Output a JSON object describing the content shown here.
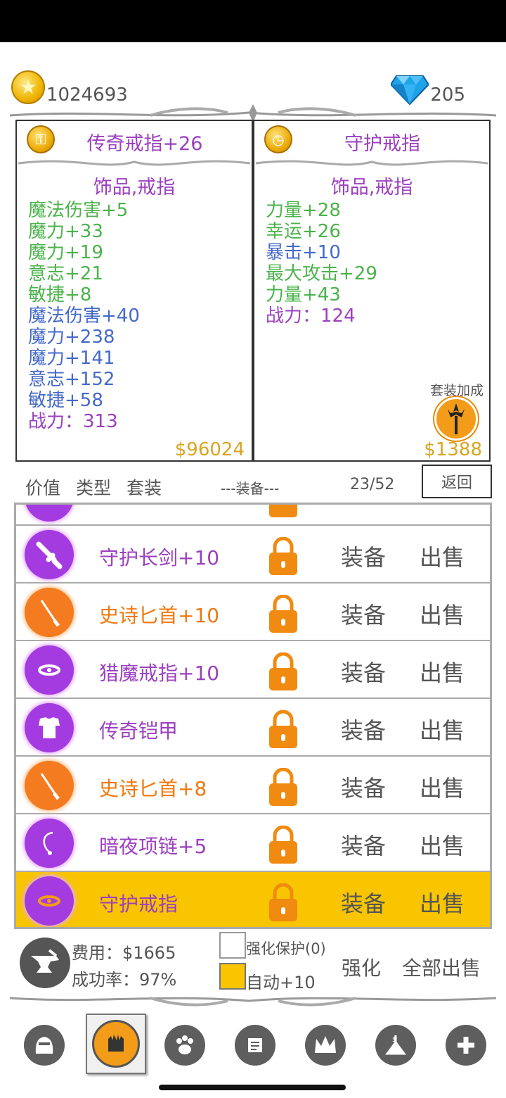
{
  "currency": {
    "gold": "1024693",
    "gems": "205"
  },
  "left_item": {
    "title": "传奇戒指+26",
    "type": "饰品,戒指",
    "stats": [
      {
        "text": "魔法伤害+5",
        "color": "green"
      },
      {
        "text": "魔力+33",
        "color": "green"
      },
      {
        "text": "魔力+19",
        "color": "green"
      },
      {
        "text": "意志+21",
        "color": "green"
      },
      {
        "text": "敏捷+8",
        "color": "green"
      },
      {
        "text": "魔法伤害+40",
        "color": "blue"
      },
      {
        "text": "魔力+238",
        "color": "blue"
      },
      {
        "text": "魔力+141",
        "color": "blue"
      },
      {
        "text": "意志+152",
        "color": "blue"
      },
      {
        "text": "敏捷+58",
        "color": "blue"
      },
      {
        "text": "战力：313",
        "color": "purple"
      }
    ],
    "price": "$96024"
  },
  "right_item": {
    "title": "守护戒指",
    "type": "饰品,戒指",
    "stats": [
      {
        "text": "力量+28",
        "color": "green"
      },
      {
        "text": "幸运+26",
        "color": "green"
      },
      {
        "text": "暴击+10",
        "color": "blue"
      },
      {
        "text": "最大攻击+29",
        "color": "green"
      },
      {
        "text": "力量+43",
        "color": "green"
      },
      {
        "text": "战力：124",
        "color": "purple"
      }
    ],
    "set_bonus_label": "套装加成",
    "price": "$1388"
  },
  "sortbar": {
    "value_label": "价值",
    "type_label": "类型",
    "set_label": "套装",
    "section_label": "---装备---",
    "count": "23/52",
    "back_label": "返回"
  },
  "inventory": [
    {
      "name": "守护长剑+10",
      "rarity": "purple",
      "icon": "sword-icon",
      "equip": "装备",
      "sell": "出售"
    },
    {
      "name": "史诗匕首+10",
      "rarity": "orange",
      "icon": "dagger-icon",
      "equip": "装备",
      "sell": "出售"
    },
    {
      "name": "猎魔戒指+10",
      "rarity": "purple",
      "icon": "ring-icon",
      "equip": "装备",
      "sell": "出售"
    },
    {
      "name": "传奇铠甲",
      "rarity": "purple",
      "icon": "armor-icon",
      "equip": "装备",
      "sell": "出售"
    },
    {
      "name": "史诗匕首+8",
      "rarity": "orange",
      "icon": "dagger-icon",
      "equip": "装备",
      "sell": "出售"
    },
    {
      "name": "暗夜项链+5",
      "rarity": "purple",
      "icon": "necklace-icon",
      "equip": "装备",
      "sell": "出售"
    },
    {
      "name": "守护戒指",
      "rarity": "purple",
      "icon": "ring-icon",
      "equip": "装备",
      "sell": "出售",
      "selected": true
    }
  ],
  "forge": {
    "cost": "费用：$1665",
    "rate": "成功率：97%",
    "protect_label": "强化保护(0)",
    "auto_label": "自动+10",
    "enhance_label": "强化",
    "sell_all_label": "全部出售"
  },
  "nav": [
    "helmet-icon",
    "gauntlet-icon",
    "paw-icon",
    "scroll-icon",
    "crown-icon",
    "shop-icon",
    "plus-icon"
  ]
}
